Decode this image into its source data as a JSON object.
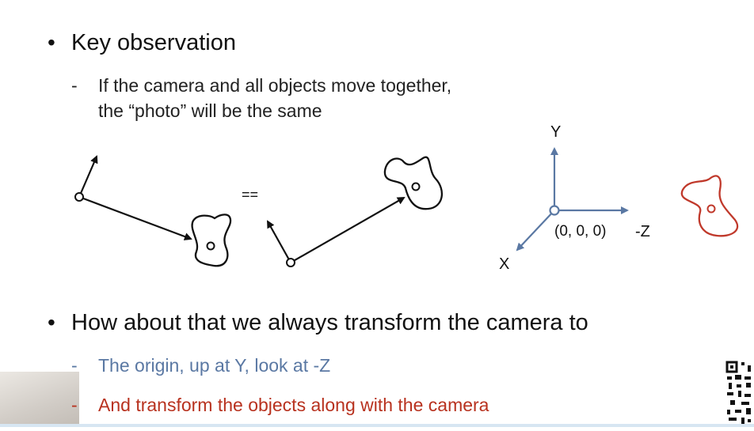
{
  "slide": {
    "bullet1": {
      "marker": "•",
      "text": "Key observation",
      "sub": {
        "marker": "-",
        "line1": "If the camera and all objects move together,",
        "line2": "the “photo” will be the same"
      }
    },
    "equals": "==",
    "axes": {
      "y_label": "Y",
      "x_label": "X",
      "origin_label": "(0, 0, 0)",
      "z_label": "-Z"
    },
    "bullet2": {
      "marker": "•",
      "text": "How about that we always transform the camera to",
      "sub1": {
        "marker": "-",
        "text": "The origin, up at Y, look at -Z"
      },
      "sub2": {
        "marker": "-",
        "text": "And transform the objects along with the camera"
      }
    },
    "colors": {
      "axis_blue": "#5a78a3",
      "object_red": "#c0392b",
      "sub_blue": "#5a78a3",
      "sub_red": "#b8321f"
    }
  }
}
